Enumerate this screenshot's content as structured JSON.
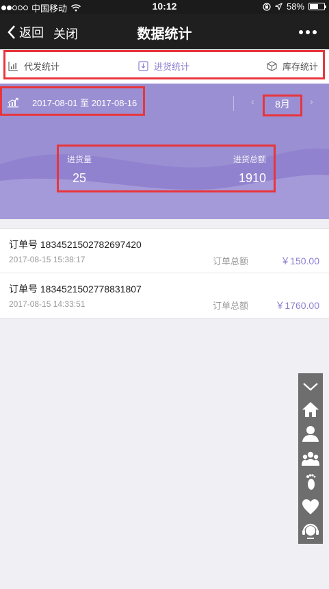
{
  "status_bar": {
    "carrier": "中国移动",
    "time": "10:12",
    "battery": "58%",
    "battery_level": 0.58
  },
  "nav": {
    "back_label": "返回",
    "close_label": "关闭",
    "title": "数据统计",
    "more_icon": "more-dots-icon"
  },
  "tabs": [
    {
      "label": "代发统计",
      "icon": "bar-chart-icon",
      "active": false
    },
    {
      "label": "进货统计",
      "icon": "download-box-icon",
      "active": true
    },
    {
      "label": "库存统计",
      "icon": "cube-icon",
      "active": false
    }
  ],
  "stats": {
    "date_range": "2017-08-01 至 2017-08-16",
    "month": "8月",
    "quantity_label": "进货量",
    "quantity_value": "25",
    "total_label": "进货总额",
    "total_value": "1910"
  },
  "orders": [
    {
      "order_no": "订单号 1834521502782697420",
      "time": "2017-08-15 15:38:17",
      "total_label": "订单总额",
      "amount": "￥150.00"
    },
    {
      "order_no": "订单号 1834521502778831807",
      "time": "2017-08-15 14:33:51",
      "total_label": "订单总额",
      "amount": "￥1760.00"
    }
  ],
  "side_bar": [
    "collapse-chevron-icon",
    "home-icon",
    "user-icon",
    "group-icon",
    "footprint-icon",
    "heart-icon",
    "customer-service-icon"
  ],
  "colors": {
    "accent": "#8b7fd0",
    "panel": "#9b8fd3",
    "highlight": "#e8353b"
  }
}
